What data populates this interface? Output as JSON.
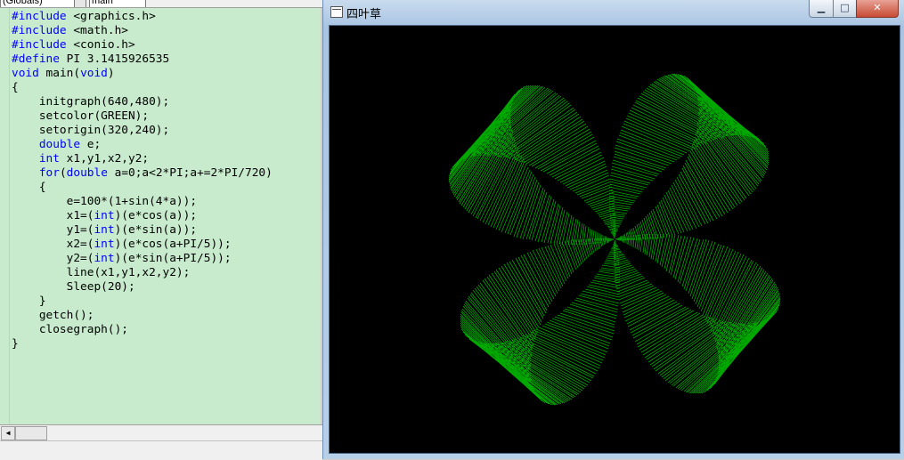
{
  "editor": {
    "toolbar": {
      "combo_left": "(Globals)",
      "combo_right": "main"
    },
    "code_lines": [
      [
        {
          "t": "#include",
          "k": 1
        },
        {
          "t": " <graphics.h>"
        }
      ],
      [
        {
          "t": "#include",
          "k": 1
        },
        {
          "t": " <math.h>"
        }
      ],
      [
        {
          "t": "#include",
          "k": 1
        },
        {
          "t": " <conio.h>"
        }
      ],
      [
        {
          "t": "#define",
          "k": 1
        },
        {
          "t": " PI 3.1415926535"
        }
      ],
      [
        {
          "t": "void",
          "k": 1
        },
        {
          "t": " main("
        },
        {
          "t": "void",
          "k": 1
        },
        {
          "t": ")"
        }
      ],
      [
        {
          "t": "{"
        }
      ],
      [
        {
          "t": "    initgraph(640,480);"
        }
      ],
      [
        {
          "t": "    setcolor(GREEN);"
        }
      ],
      [
        {
          "t": "    setorigin(320,240);"
        }
      ],
      [
        {
          "t": "    "
        },
        {
          "t": "double",
          "k": 1
        },
        {
          "t": " e;"
        }
      ],
      [
        {
          "t": "    "
        },
        {
          "t": "int",
          "k": 1
        },
        {
          "t": " x1,y1,x2,y2;"
        }
      ],
      [
        {
          "t": "    "
        },
        {
          "t": "for",
          "k": 1
        },
        {
          "t": "("
        },
        {
          "t": "double",
          "k": 1
        },
        {
          "t": " a=0;a<2*PI;a+=2*PI/720)"
        }
      ],
      [
        {
          "t": "    {"
        }
      ],
      [
        {
          "t": "        e=100*(1+sin(4*a));"
        }
      ],
      [
        {
          "t": "        x1=("
        },
        {
          "t": "int",
          "k": 1
        },
        {
          "t": ")(e*cos(a));"
        }
      ],
      [
        {
          "t": "        y1=("
        },
        {
          "t": "int",
          "k": 1
        },
        {
          "t": ")(e*sin(a));"
        }
      ],
      [
        {
          "t": "        x2=("
        },
        {
          "t": "int",
          "k": 1
        },
        {
          "t": ")(e*cos(a+PI/5));"
        }
      ],
      [
        {
          "t": "        y2=("
        },
        {
          "t": "int",
          "k": 1
        },
        {
          "t": ")(e*sin(a+PI/5));"
        }
      ],
      [
        {
          "t": "        line(x1,y1,x2,y2);"
        }
      ],
      [
        {
          "t": "        Sleep(20);"
        }
      ],
      [
        {
          "t": "    }"
        }
      ],
      [
        {
          "t": "    getch();"
        }
      ],
      [
        {
          "t": "    closegraph();"
        }
      ],
      [
        {
          "t": "}"
        }
      ]
    ],
    "scroll_left_icon": "triangle-left-icon"
  },
  "graphics_window": {
    "title": "四叶草",
    "app_icon": "window-icon",
    "buttons": {
      "minimize": "▁",
      "maximize": "□",
      "close": "✕"
    },
    "canvas": {
      "background": "#000000",
      "line_color": "#00a800",
      "drawing": {
        "function": "e=100*(1+sin(4*a))",
        "steps": 720,
        "angle_offset": "PI/5"
      }
    }
  }
}
